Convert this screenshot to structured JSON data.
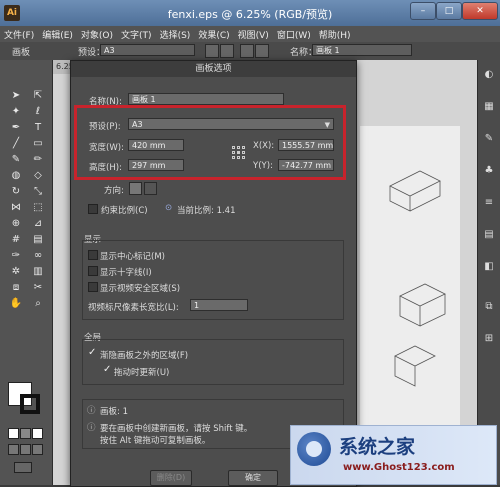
{
  "window": {
    "app_icon": "Ai",
    "title": "fenxi.eps @ 6.25% (RGB/预览)",
    "min": "–",
    "max": "□",
    "close": "✕"
  },
  "menu": [
    "文件(F)",
    "编辑(E)",
    "对象(O)",
    "文字(T)",
    "选择(S)",
    "效果(C)",
    "视图(V)",
    "窗口(W)",
    "帮助(H)"
  ],
  "controlbar": {
    "artboard_label": "画板",
    "preset_label": "预设：",
    "preset_value": "A3",
    "name_label": "名称：",
    "name_value": "画板 1"
  },
  "document": {
    "tab": "6.25%"
  },
  "dialog": {
    "title": "画板选项",
    "name_label": "名称(N):",
    "name_value": "画板 1",
    "preset_label": "预设(P):",
    "preset_value": "A3",
    "width_label": "宽度(W):",
    "width_value": "420 mm",
    "height_label": "高度(H):",
    "height_value": "297 mm",
    "x_label": "X(X):",
    "x_value": "1555.57 mm",
    "y_label": "Y(Y):",
    "y_value": "-742.77 mm",
    "orientation_label": "方向:",
    "constrain_label": "约束比例(C)",
    "ratio_text": "当前比例: 1.41",
    "display_title": "显示",
    "show_center": "显示中心标记(M)",
    "show_cross": "显示十字线(I)",
    "show_safe": "显示视频安全区域(S)",
    "pixel_ratio_label": "视频标尺像素长宽比(L):",
    "pixel_ratio_value": "1",
    "global_title": "全局",
    "fade_outside": "渐隐画板之外的区域(F)",
    "update_drag": "拖动时更新(U)",
    "artboard_count": "画板: 1",
    "hint_line1": "要在画板中创建新画板，请按 Shift 键。",
    "hint_line2": "按住 Alt 键拖动可复制画板。",
    "delete_label": "删除(D)",
    "ok_label": "确定"
  },
  "watermark": {
    "title": "系统之家",
    "url": "www.Ghost123.com"
  }
}
